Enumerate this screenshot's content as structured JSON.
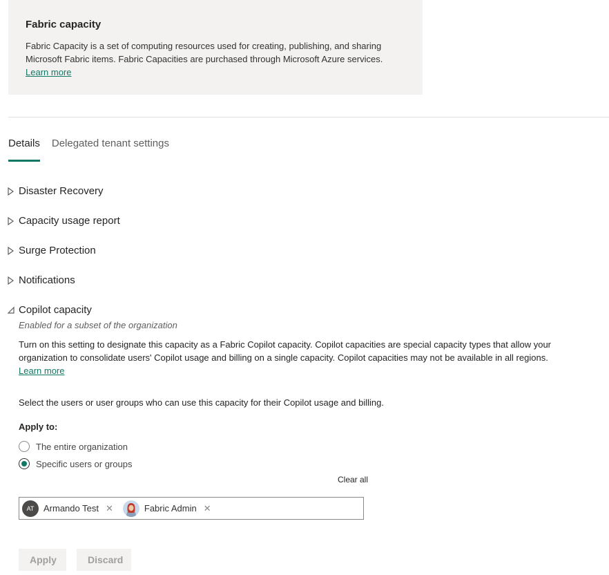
{
  "info_card": {
    "title": "Fabric capacity",
    "description": "Fabric Capacity is a set of computing resources used for creating, publishing, and sharing Microsoft Fabric items. Fabric Capacities are purchased through Microsoft Azure services.",
    "link_text": "Learn more"
  },
  "tabs": [
    {
      "label": "Details",
      "active": true
    },
    {
      "label": "Delegated tenant settings",
      "active": false
    }
  ],
  "sections": [
    {
      "label": "Disaster Recovery",
      "expanded": false
    },
    {
      "label": "Capacity usage report",
      "expanded": false
    },
    {
      "label": "Surge Protection",
      "expanded": false
    },
    {
      "label": "Notifications",
      "expanded": false
    },
    {
      "label": "Copilot capacity",
      "expanded": true
    }
  ],
  "copilot": {
    "status": "Enabled for a subset of the organization",
    "description": "Turn on this setting to designate this capacity as a Fabric Copilot capacity. Copilot capacities are special capacity types that allow your organization to consolidate users' Copilot usage and billing on a single capacity. Copilot capacities may not be available in all regions.",
    "link_text": "Learn more",
    "select_text": "Select the users or user groups who can use this capacity for their Copilot usage and billing.",
    "apply_to_label": "Apply to:",
    "options": [
      {
        "label": "The entire organization",
        "checked": false
      },
      {
        "label": "Specific users or groups",
        "checked": true
      }
    ],
    "clear_all": "Clear all",
    "people": [
      {
        "initials": "AT",
        "name": "Armando Test",
        "avatar": "initials"
      },
      {
        "initials": "",
        "name": "Fabric Admin",
        "avatar": "photo-avatar"
      }
    ],
    "remove_glyph": "✕"
  },
  "buttons": {
    "apply": "Apply",
    "discard": "Discard"
  },
  "colors": {
    "accent": "#117865",
    "card_bg": "#f3f2f1",
    "disabled_text": "#a19f9d"
  }
}
